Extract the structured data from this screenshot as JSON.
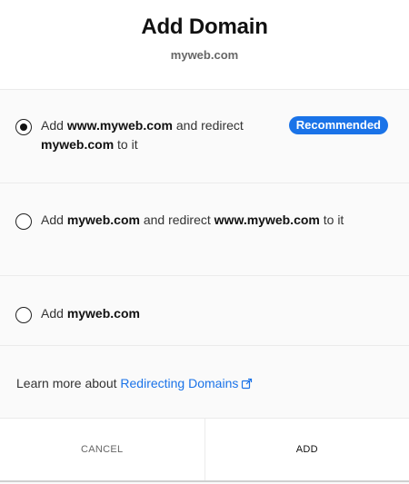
{
  "header": {
    "title": "Add Domain",
    "subtitle": "myweb.com"
  },
  "options": [
    {
      "selected": true,
      "p1": "Add ",
      "b1": "www.myweb.com",
      "p2": " and redirect ",
      "b2": "myweb.com",
      "p3": " to it",
      "badge": "Recommended"
    },
    {
      "selected": false,
      "p1": "Add ",
      "b1": "myweb.com",
      "p2": " and redirect ",
      "b2": "www.myweb.com",
      "p3": " to it"
    },
    {
      "selected": false,
      "p1": "Add ",
      "b1": "myweb.com"
    }
  ],
  "learn_more": {
    "text": "Learn more about ",
    "link": "Redirecting Domains",
    "icon": "external-link-icon"
  },
  "footer": {
    "cancel": "CANCEL",
    "add": "ADD"
  },
  "colors": {
    "accent": "#1a73e8",
    "badge_text": "#ffffff"
  }
}
